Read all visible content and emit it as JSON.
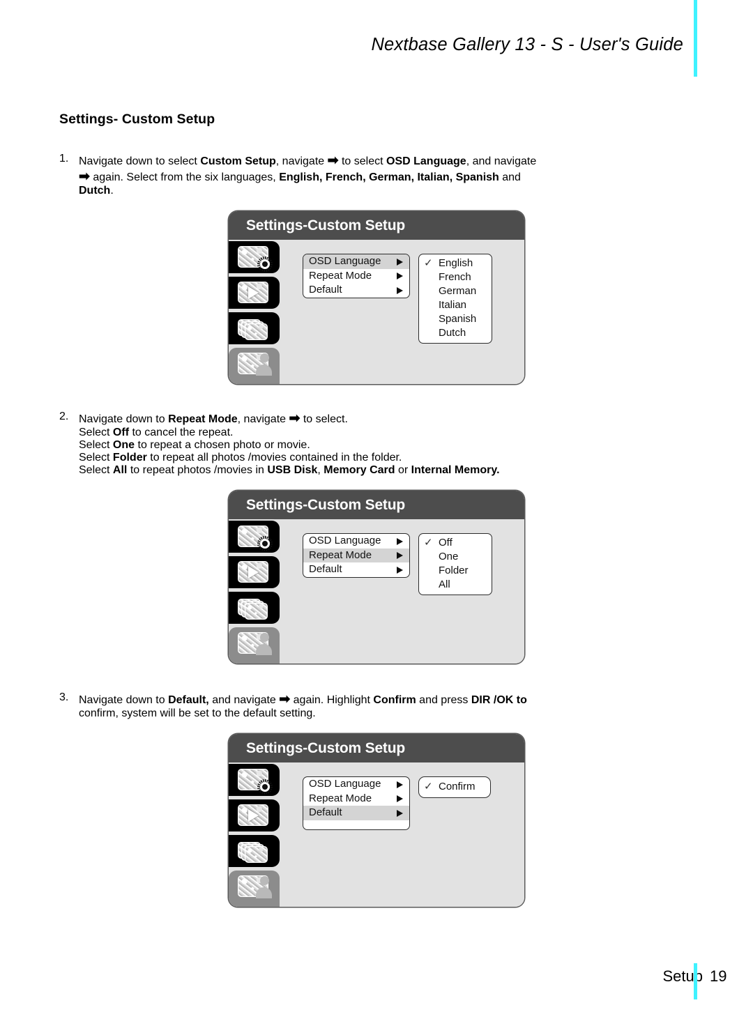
{
  "header": {
    "title": "Nextbase Gallery 13 - S - User's Guide",
    "rule_color": "#3ff2ff"
  },
  "section": {
    "title": "Settings- Custom Setup"
  },
  "steps": [
    {
      "number": "1.",
      "lines": [
        "Navigate down to select Custom Setup, navigate ➡ to select OSD Language, and navigate",
        "➡ again. Select from the six languages, English, French, German, Italian, Spanish and",
        "Dutch."
      ]
    },
    {
      "number": "2.",
      "lines": [
        "Navigate down to Repeat Mode, navigate ➡ to select.",
        "Select Off to cancel the repeat.",
        "Select One to repeat a chosen photo or movie.",
        "Select Folder to repeat all photos /movies contained in the folder.",
        "Select All to repeat photos /movies in USB Disk, Memory Card or Internal Memory."
      ]
    },
    {
      "number": "3.",
      "lines": [
        "Navigate down to Default, and navigate ➡ again. Highlight Confirm and press DIR /OK to",
        "confirm, system will be set to the default setting."
      ]
    }
  ],
  "step1_text": {
    "l1_a": "Navigate down to select ",
    "l1_b": "Custom Setup",
    "l1_c": ", navigate ",
    "l1_arrow": "➡",
    "l1_d": " to select ",
    "l1_e": "OSD Language",
    "l1_f": ", and navigate",
    "l2_arrow": "➡",
    "l2_a": " again. Select from the six languages, ",
    "l2_b": "English, French, German, Italian, Spanish",
    "l2_c": " and",
    "l3_a": "Dutch",
    "l3_b": "."
  },
  "step2_text": {
    "l1_a": "Navigate down to ",
    "l1_b": "Repeat Mode",
    "l1_c": ", navigate ",
    "l1_arrow": "➡",
    "l1_d": " to select.",
    "l2_a": "Select ",
    "l2_b": "Off",
    "l2_c": " to cancel the repeat.",
    "l3_a": "Select ",
    "l3_b": "One",
    "l3_c": " to repeat a chosen photo or movie.",
    "l4_a": "Select ",
    "l4_b": "Folder",
    "l4_c": " to repeat all photos /movies contained in the folder.",
    "l5_a": "Select ",
    "l5_b": "All",
    "l5_c": " to repeat photos /movies in ",
    "l5_d": "USB Disk",
    "l5_e": ", ",
    "l5_f": "Memory Card",
    "l5_g": " or ",
    "l5_h": "Internal Memory."
  },
  "step3_text": {
    "l1_a": "Navigate down to ",
    "l1_b": "Default,",
    "l1_c": " and navigate ",
    "l1_arrow": "➡",
    "l1_d": " again. Highlight ",
    "l1_e": "Confirm",
    "l1_f": " and press ",
    "l1_g": "DIR /OK to",
    "l2_a": "confirm, system will be set to the default setting."
  },
  "screens": [
    {
      "title": "Settings-Custom Setup",
      "sidebar": [
        {
          "icon": "photo-settings-icon",
          "selected": false
        },
        {
          "icon": "video-play-icon",
          "selected": false
        },
        {
          "icon": "folder-stack-icon",
          "selected": false
        },
        {
          "icon": "user-profile-icon",
          "selected": true
        }
      ],
      "menu": [
        {
          "label": "OSD Language",
          "highlighted": true
        },
        {
          "label": "Repeat Mode",
          "highlighted": false
        },
        {
          "label": "Default",
          "highlighted": false
        }
      ],
      "submenu": {
        "kind": "list",
        "options": [
          {
            "label": "English",
            "checked": true
          },
          {
            "label": "French",
            "checked": false
          },
          {
            "label": "German",
            "checked": false
          },
          {
            "label": "Italian",
            "checked": false
          },
          {
            "label": "Spanish",
            "checked": false
          },
          {
            "label": "Dutch",
            "checked": false
          }
        ]
      }
    },
    {
      "title": "Settings-Custom Setup",
      "sidebar": [
        {
          "icon": "photo-settings-icon",
          "selected": false
        },
        {
          "icon": "video-play-icon",
          "selected": false
        },
        {
          "icon": "folder-stack-icon",
          "selected": false
        },
        {
          "icon": "user-profile-icon",
          "selected": true
        }
      ],
      "menu": [
        {
          "label": "OSD Language",
          "highlighted": false
        },
        {
          "label": "Repeat Mode",
          "highlighted": true
        },
        {
          "label": "Default",
          "highlighted": false
        }
      ],
      "submenu": {
        "kind": "list",
        "options": [
          {
            "label": "Off",
            "checked": true
          },
          {
            "label": "One",
            "checked": false
          },
          {
            "label": "Folder",
            "checked": false
          },
          {
            "label": "All",
            "checked": false
          }
        ]
      }
    },
    {
      "title": "Settings-Custom Setup",
      "sidebar": [
        {
          "icon": "photo-settings-icon",
          "selected": false
        },
        {
          "icon": "video-play-icon",
          "selected": false
        },
        {
          "icon": "folder-stack-icon",
          "selected": false
        },
        {
          "icon": "user-profile-icon",
          "selected": true
        }
      ],
      "menu": [
        {
          "label": "OSD Language",
          "highlighted": false
        },
        {
          "label": "Repeat Mode",
          "highlighted": false
        },
        {
          "label": "Default",
          "highlighted": true
        }
      ],
      "submenu": {
        "kind": "button",
        "options": [
          {
            "label": "Confirm",
            "checked": true
          }
        ]
      }
    }
  ],
  "footer": {
    "label": "Setup",
    "page": "19",
    "rule_color": "#3ff2ff"
  },
  "glyphs": {
    "check": "✓",
    "arrow": "➡",
    "triangle": "▶"
  }
}
